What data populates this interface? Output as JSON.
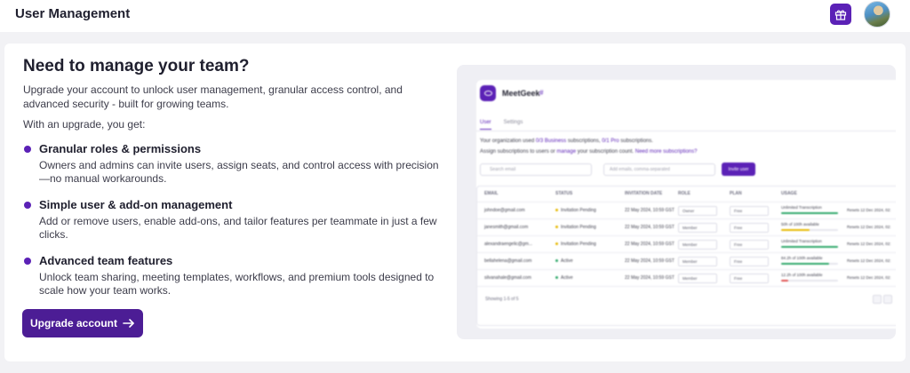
{
  "header": {
    "title": "User Management",
    "gift_icon": "gift-icon",
    "avatar_icon": "user-avatar"
  },
  "promo": {
    "headline": "Need to manage your team?",
    "intro": "Upgrade your account to unlock user management, granular access control, and advanced security - built for growing teams.",
    "with_upgrade": "With an upgrade, you get:",
    "features": [
      {
        "title": "Granular roles & permissions",
        "description": "Owners and admins can invite users, assign seats, and control access with precision—no manual workarounds."
      },
      {
        "title": "Simple user & add-on management",
        "description": "Add or remove users, enable add-ons, and tailor features per teammate in just a few clicks."
      },
      {
        "title": "Advanced team features",
        "description": "Unlock team sharing, meeting templates, workflows, and premium tools designed to scale how your team works."
      }
    ],
    "button_label": "Upgrade account"
  },
  "preview": {
    "brand": "MeetGeek",
    "hash": "#",
    "tabs": [
      "User",
      "Settings"
    ],
    "line1_pre": "Your organization used ",
    "line1_b1": "0/3 Business",
    "line1_mid": " subscriptions, ",
    "line1_b2": "0/1 Pro",
    "line1_post": " subscriptions.",
    "line2_pre": "Assign subscriptions to users or ",
    "line2_b1": "manage",
    "line2_mid": " your subscription count. ",
    "line2_b2": "Need more subscriptions?",
    "search_placeholder": "Search email",
    "add_emails_placeholder": "Add emails, comma-separated",
    "invite_label": "Invite user",
    "columns": [
      "EMAIL",
      "STATUS",
      "INVITATION DATE",
      "ROLE",
      "PLAN",
      "USAGE"
    ],
    "rows": [
      {
        "email": "johndoe@gmail.com",
        "status": "Invitation Pending",
        "date": "22 May 2024, 10:59 GST",
        "role": "Owner",
        "plan": "Free",
        "usage": "Unlimited Transcription",
        "reset": "Resets 12 Dec 2024, 02:"
      },
      {
        "email": "janesmith@gmail.com",
        "status": "Invitation Pending",
        "date": "22 May 2024, 10:59 GST",
        "role": "Member",
        "plan": "Free",
        "usage": "50h of 100h available",
        "reset": "Resets 12 Dec 2024, 02:"
      },
      {
        "email": "alexandraengelic@gm...",
        "status": "Invitation Pending",
        "date": "22 May 2024, 10:59 GST",
        "role": "Member",
        "plan": "Free",
        "usage": "Unlimited Transcription",
        "reset": "Resets 12 Dec 2024, 02:"
      },
      {
        "email": "bellahelena@gmail.com",
        "status": "Active",
        "date": "22 May 2024, 10:59 GST",
        "role": "Member",
        "plan": "Free",
        "usage": "84.2h of 100h available",
        "reset": "Resets 12 Dec 2024, 02:"
      },
      {
        "email": "silvanahale@gmail.com",
        "status": "Active",
        "date": "22 May 2024, 10:59 GST",
        "role": "Member",
        "plan": "Free",
        "usage": "12.2h of 100h available",
        "reset": "Resets 12 Dec 2024, 02:"
      }
    ],
    "footer": "Showing 1-5 of 5"
  },
  "colors": {
    "brand": "#5b21b6",
    "button": "#4c1d95",
    "pending": "#e6b800",
    "active": "#2fa86a"
  }
}
